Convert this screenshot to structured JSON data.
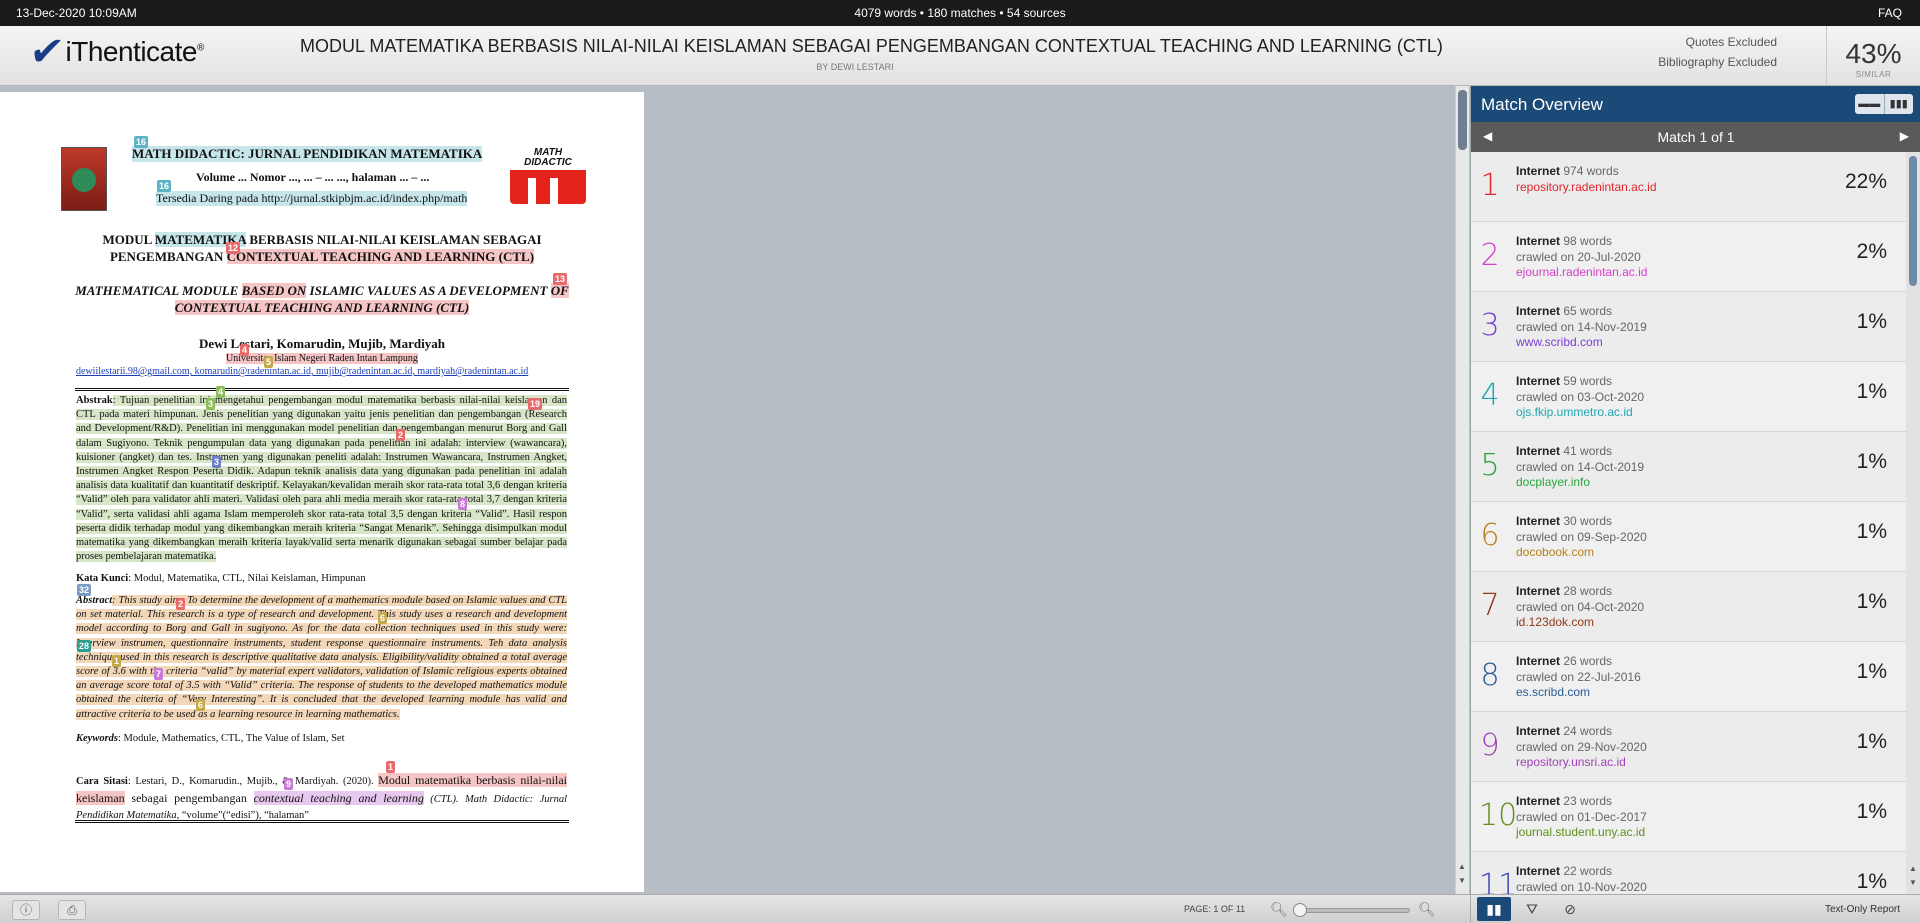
{
  "topbar": {
    "datetime": "13-Dec-2020 10:09AM",
    "stats": "4079 words • 180 matches • 54 sources",
    "faq": "FAQ"
  },
  "header": {
    "logo_text": "iThenticate",
    "logo_mark": "®",
    "doc_title": "MODUL MATEMATIKA BERBASIS NILAI-NILAI KEISLAMAN SEBAGAI PENGEMBANGAN CONTEXTUAL TEACHING AND LEARNING (CTL)",
    "doc_author": "BY DEWI LESTARI",
    "quotes_excluded": "Quotes Excluded",
    "bibliography_excluded": "Bibliography Excluded",
    "similarity": "43%",
    "similarity_label": "SIMILAR"
  },
  "document": {
    "journal_title": "MATH DIDACTIC: JURNAL PENDIDIKAN MATEMATIKA",
    "journal_volume": "Volume ... Nomor ..., ... – ... ..., halaman ... – ...",
    "journal_url": "Tersedia Daring pada http://jurnal.stkipbjm.ac.id/index.php/math",
    "logo_text_1": "MATH",
    "logo_text_2": "DIDACTIC",
    "title_line1_a": "MODUL ",
    "title_line1_b": "MATEMATIKA",
    "title_line1_c": " BERBASIS NILAI-NILAI KEISLAMAN SEBAGAI",
    "title_line2_a": "PENGEMBANGAN ",
    "title_line2_b": "CONTEXTUAL TEACHING AND LEARNING (CTL)",
    "en_line1_a": "MATHEMATICAL MODULE ",
    "en_line1_b": "BASED ON",
    "en_line1_c": " ISLAMIC VALUES AS A DEVELOPMENT ",
    "en_line1_d": "OF",
    "en_line2": "CONTEXTUAL TEACHING AND LEARNING (CTL)",
    "authors": "Dewi Lestari, Komarudin, Mujib, Mardiyah",
    "university": "Universitas Islam Negeri Raden Intan Lampung",
    "emails": "dewiilestarii.98@gmail.com, komarudin@radenintan.ac.id, mujib@radenintan.ac.id, mardiyah@radenintan.ac.id",
    "abstrak_label": "Abstrak",
    "abstrak_text": ": Tujuan penelitian ini mengetahui pengembangan modul matematika berbasis nilai-nilai keislaman dan CTL pada materi himpunan. Jenis penelitian yang digunakan yaitu jenis penelitian dan pengembangan (Research and Development/R&D). Penelitian ini menggunakan model penelitian dan pengembangan menurut Borg and Gall dalam Sugiyono. Teknik pengumpulan data yang digunakan pada penelitian ini adalah: interview (wawancara), kuisioner (angket) dan tes. Instrumen yang digunakan peneliti adalah: Instrumen Wawancara, Instrumen Angket, Instrumen Angket Respon Peserta Didik. Adapun teknik analisis data yang digunakan pada penelitian ini adalah analisis data kualitatif dan kuantitatif deskriptif. Kelayakan/kevalidan meraih skor rata-rata total 3,6 dengan kriteria “Valid” oleh para validator ahli materi. Validasi oleh para ahli media meraih skor rata-rata total 3,7 dengan kriteria “Valid”, serta validasi ahli agama Islam memperoleh skor rata-rata total 3,5 dengan kriteria “Valid”. Hasil respon peserta didik terhadap modul yang dikembangkan meraih kriteria “Sangat Menarik”. Sehingga disimpulkan modul matematika yang dikembangkan meraih kriteria layak/valid serta menarik digunakan sebagai sumber belajar pada proses pembelajaran matematika.",
    "kata_kunci_label": "Kata Kunci",
    "kata_kunci_text": ": Modul, Matematika, CTL, Nilai Keislaman, Himpunan",
    "abstract_label": "Abstract",
    "abstract_text": ": This study aims To determine the development of a mathematics module based on Islamic values and CTL on set material. This research is a type of research and development. This study uses a research and development model according to Borg and Gall in sugiyono. As for the data collection techniques used in this study were: Interview instrumen, questionnaire instruments, student response questionnaire instruments. Teh data analysis technique used in this research is descriptive qualitative data analysis. Eligibility/validity obtained a total average score of 3.6 with the criteria “valid” by material expert validators, validation of Islamic religious experts obtained an average score total of 3.5 with “Valid” criteria. The response of students to the developed mathematics module obtained the citeria of “Very Interesting”. It is concluded that the developed learning module has valid and attractive criteria to be used as a learning resource in learning mathematics.",
    "keywords_label": "Keywords",
    "keywords_text": ": Module, Mathematics, CTL, The Value of Islam, Set",
    "citation_label": "Cara Sitasi",
    "citation_text_a": ": Lestari, D., Komarudin., Mujib., & Mardiyah. (2020). ",
    "citation_text_b": "Modul matematika berbasis nilai-nilai keislaman",
    "citation_text_c": " sebagai pengembangan ",
    "citation_text_d": "contextual teaching and learning",
    "citation_text_e": " (CTL). Math Didactic: Jurnal Pendidikan Matematika",
    "citation_text_f": ", “volume”(“edisi”), “halaman”",
    "tags": [
      "16",
      "16",
      "12",
      "13",
      "4",
      "5",
      "4",
      "3",
      "19",
      "2",
      "3",
      "8",
      "32",
      "2",
      "6",
      "28",
      "1",
      "7",
      "6",
      "1",
      "9"
    ]
  },
  "panel": {
    "title": "Match Overview",
    "nav_label": "Match 1 of 1",
    "items": [
      {
        "num": "1",
        "source": "Internet",
        "words": "974 words",
        "crawled": "",
        "url": "repository.radenintan.ac.id",
        "pct": "22%",
        "color": "#e0242c"
      },
      {
        "num": "2",
        "source": "Internet",
        "words": "98 words",
        "crawled": "crawled on 20-Jul-2020",
        "url": "ejournal.radenintan.ac.id",
        "pct": "2%",
        "color": "#d63fc9"
      },
      {
        "num": "3",
        "source": "Internet",
        "words": "65 words",
        "crawled": "crawled on 14-Nov-2019",
        "url": "www.scribd.com",
        "pct": "1%",
        "color": "#7a3fd0"
      },
      {
        "num": "4",
        "source": "Internet",
        "words": "59 words",
        "crawled": "crawled on 03-Oct-2020",
        "url": "ojs.fkip.ummetro.ac.id",
        "pct": "1%",
        "color": "#1ca7b3"
      },
      {
        "num": "5",
        "source": "Internet",
        "words": "41 words",
        "crawled": "crawled on 14-Oct-2019",
        "url": "docplayer.info",
        "pct": "1%",
        "color": "#2aa63b"
      },
      {
        "num": "6",
        "source": "Internet",
        "words": "30 words",
        "crawled": "crawled on 09-Sep-2020",
        "url": "docobook.com",
        "pct": "1%",
        "color": "#b57f1c"
      },
      {
        "num": "7",
        "source": "Internet",
        "words": "28 words",
        "crawled": "crawled on 04-Oct-2020",
        "url": "id.123dok.com",
        "pct": "1%",
        "color": "#8f3a1a"
      },
      {
        "num": "8",
        "source": "Internet",
        "words": "26 words",
        "crawled": "crawled on 22-Jul-2016",
        "url": "es.scribd.com",
        "pct": "1%",
        "color": "#2a5b99"
      },
      {
        "num": "9",
        "source": "Internet",
        "words": "24 words",
        "crawled": "crawled on 29-Nov-2020",
        "url": "repository.unsri.ac.id",
        "pct": "1%",
        "color": "#a23fb8"
      },
      {
        "num": "10",
        "source": "Internet",
        "words": "23 words",
        "crawled": "crawled on 01-Dec-2017",
        "url": "journal.student.uny.ac.id",
        "pct": "1%",
        "color": "#5f8f1c"
      },
      {
        "num": "11",
        "source": "Internet",
        "words": "22 words",
        "crawled": "crawled on 10-Nov-2020",
        "url": "",
        "pct": "1%",
        "color": "#3a3fb8"
      }
    ]
  },
  "bottom": {
    "page_label": "PAGE: 1 OF 11",
    "zoom_fraction": 0.0,
    "text_only": "Text-Only Report"
  },
  "icons": {
    "info": "info-icon",
    "print": "print-icon",
    "zoom_out": "zoom-out-icon",
    "zoom_in": "zoom-in-icon",
    "overview": "bar-chart-icon",
    "filter": "filter-icon",
    "exclude": "exclude-icon"
  }
}
